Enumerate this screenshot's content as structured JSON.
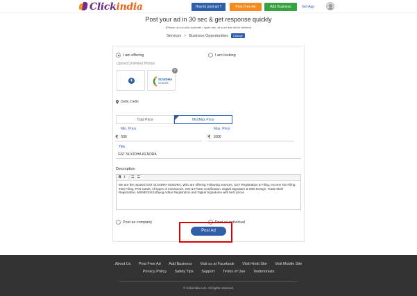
{
  "header": {
    "logo_text_1": "Click",
    "logo_text_2": "india",
    "how_to_post": "How to post ad ?",
    "post_free_ad": "Post Free Ad",
    "add_business": "Add Business",
    "get_app": "Get App"
  },
  "page": {
    "title": "Post your ad in 30 sec & get response quickly",
    "subtitle": "(Please do not post duplicate / spam ads, all such ads will be deleted)",
    "breadcrumb_1": "Services",
    "breadcrumb_sep": ">",
    "breadcrumb_2": "Business Opportunities",
    "change_label": "Change"
  },
  "form": {
    "offering_label": "I am offering",
    "looking_label": "I am looking",
    "upload_label": "Upload Unlimited Photos",
    "plus_symbol": "+",
    "close_symbol": "×",
    "photo_text_1": "SUVIDHA",
    "photo_text_2": "KENDRA",
    "location": "Delhi, Delhi",
    "price_tabs": [
      "Total Price",
      "Min/Max Price"
    ],
    "min_label": "Min. Price",
    "max_label": "Max. Price",
    "rupee_symbol": "₹",
    "min_value": "500",
    "max_value": "1000",
    "title_label": "Title",
    "title_value": "GST SUVIDHA KENDRA",
    "description_label": "Description",
    "toolbar": [
      "B",
      "I",
      "⋮☰",
      "☰"
    ],
    "description_text": "We are the reputed GST SUVIDHA KENDRA. Who are offering Following services. GST Registration & Filing, Income Tax Filing, TDS Filing, PAN Cards, All types of Insurances, ISO & FASSI Certification, Digital Signature & Web Design, Trade Mark Registration, MSME/SSI/Udhyog Adhar Registration and Digital Signatures with best prices",
    "post_as_company": "Post as company",
    "post_as_individual": "Post as individual",
    "post_ad_button": "Post Ad"
  },
  "footer": {
    "row1": [
      "About Us",
      "Post Free Ad",
      "Add Business",
      "Visit us at Facebook",
      "Visit Hindi Site",
      "Visit Mobile Site"
    ],
    "row2": [
      "Privacy Policy",
      "Safety Tips",
      "Support",
      "Terms of Use",
      "Testimonials"
    ],
    "copyright": "© Clickindia.com. All rights reserved."
  },
  "colors": {
    "brand_blue": "#2f5fa8",
    "orange": "#f58a1f",
    "green": "#36a340",
    "highlight_red": "#d00000",
    "footer_bg": "#333333"
  }
}
